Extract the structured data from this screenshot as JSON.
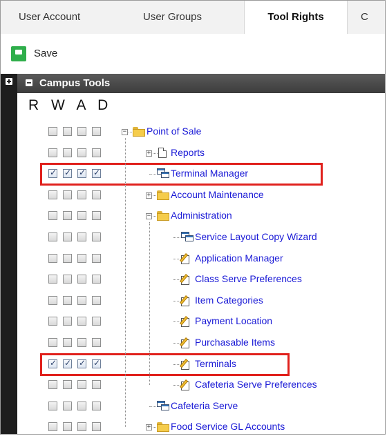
{
  "tabs": [
    {
      "label": "User Account",
      "active": false
    },
    {
      "label": "User Groups",
      "active": false
    },
    {
      "label": "Tool Rights",
      "active": true
    },
    {
      "label": "C",
      "active": false
    }
  ],
  "toolbar": {
    "save_label": "Save",
    "save_icon": "floppy-disk-icon",
    "accent": "#2fae4b"
  },
  "panel": {
    "title": "Campus Tools",
    "permission_headers": "R W A D"
  },
  "highlight_color": "#e0201c",
  "link_color": "#1a1ad6",
  "tree": [
    {
      "label": "Point of Sale",
      "icon": "folder-icon",
      "toggle": "minus",
      "level": 0,
      "rights": [
        false,
        false,
        false,
        false
      ]
    },
    {
      "label": "Reports",
      "icon": "page-icon",
      "toggle": "plus",
      "level": 1,
      "rights": [
        false,
        false,
        false,
        false
      ]
    },
    {
      "label": "Terminal Manager",
      "icon": "windows-icon",
      "toggle": "none",
      "level": 1,
      "rights": [
        true,
        true,
        true,
        true
      ],
      "highlighted": true
    },
    {
      "label": "Account Maintenance",
      "icon": "folder-icon",
      "toggle": "plus",
      "level": 1,
      "rights": [
        false,
        false,
        false,
        false
      ]
    },
    {
      "label": "Administration",
      "icon": "folder-icon",
      "toggle": "minus",
      "level": 1,
      "rights": [
        false,
        false,
        false,
        false
      ]
    },
    {
      "label": "Service Layout Copy Wizard",
      "icon": "windows-icon",
      "toggle": "none",
      "level": 2,
      "rights": [
        false,
        false,
        false,
        false
      ]
    },
    {
      "label": "Application Manager",
      "icon": "edit-icon",
      "toggle": "none",
      "level": 2,
      "rights": [
        false,
        false,
        false,
        false
      ]
    },
    {
      "label": "Class Serve Preferences",
      "icon": "edit-icon",
      "toggle": "none",
      "level": 2,
      "rights": [
        false,
        false,
        false,
        false
      ]
    },
    {
      "label": "Item Categories",
      "icon": "edit-icon",
      "toggle": "none",
      "level": 2,
      "rights": [
        false,
        false,
        false,
        false
      ]
    },
    {
      "label": "Payment Location",
      "icon": "edit-icon",
      "toggle": "none",
      "level": 2,
      "rights": [
        false,
        false,
        false,
        false
      ]
    },
    {
      "label": "Purchasable Items",
      "icon": "edit-icon",
      "toggle": "none",
      "level": 2,
      "rights": [
        false,
        false,
        false,
        false
      ]
    },
    {
      "label": "Terminals",
      "icon": "edit-icon",
      "toggle": "none",
      "level": 2,
      "rights": [
        true,
        true,
        true,
        true
      ],
      "highlighted": true
    },
    {
      "label": "Cafeteria Serve Preferences",
      "icon": "edit-icon",
      "toggle": "none",
      "level": 2,
      "rights": [
        false,
        false,
        false,
        false
      ]
    },
    {
      "label": "Cafeteria Serve",
      "icon": "windows-icon",
      "toggle": "none",
      "level": 1,
      "rights": [
        false,
        false,
        false,
        false
      ]
    },
    {
      "label": "Food Service GL Accounts",
      "icon": "folder-icon",
      "toggle": "plus",
      "level": 1,
      "rights": [
        false,
        false,
        false,
        false
      ]
    }
  ]
}
